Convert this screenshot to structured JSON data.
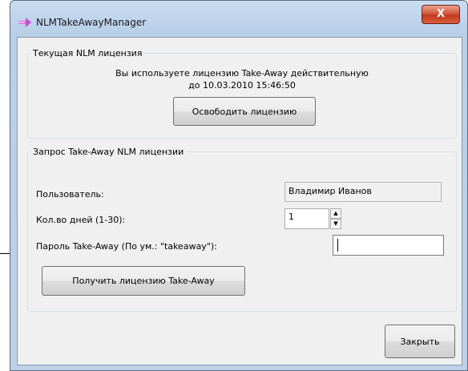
{
  "window": {
    "title": "NLMTakeAwayManager",
    "close_label": "X"
  },
  "license_group": {
    "legend": "Текущая NLM лицензия",
    "status_line1": "Вы используете лицензию Take-Away действительную",
    "status_line2": "до 10.03.2010 15:46:50",
    "release_button": "Освободить лицензию"
  },
  "request_group": {
    "legend": "Запрос Take-Away NLM лицензии",
    "user_label": "Пользователь:",
    "user_value": "Владимир Иванов",
    "days_label": "Кол.во дней (1-30):",
    "days_value": "1",
    "password_label": "Пароль Take-Away (По ум.: \"takeaway\"):",
    "password_value": "",
    "get_button": "Получить лицензию Take-Away"
  },
  "footer": {
    "close_button": "Закрыть"
  }
}
